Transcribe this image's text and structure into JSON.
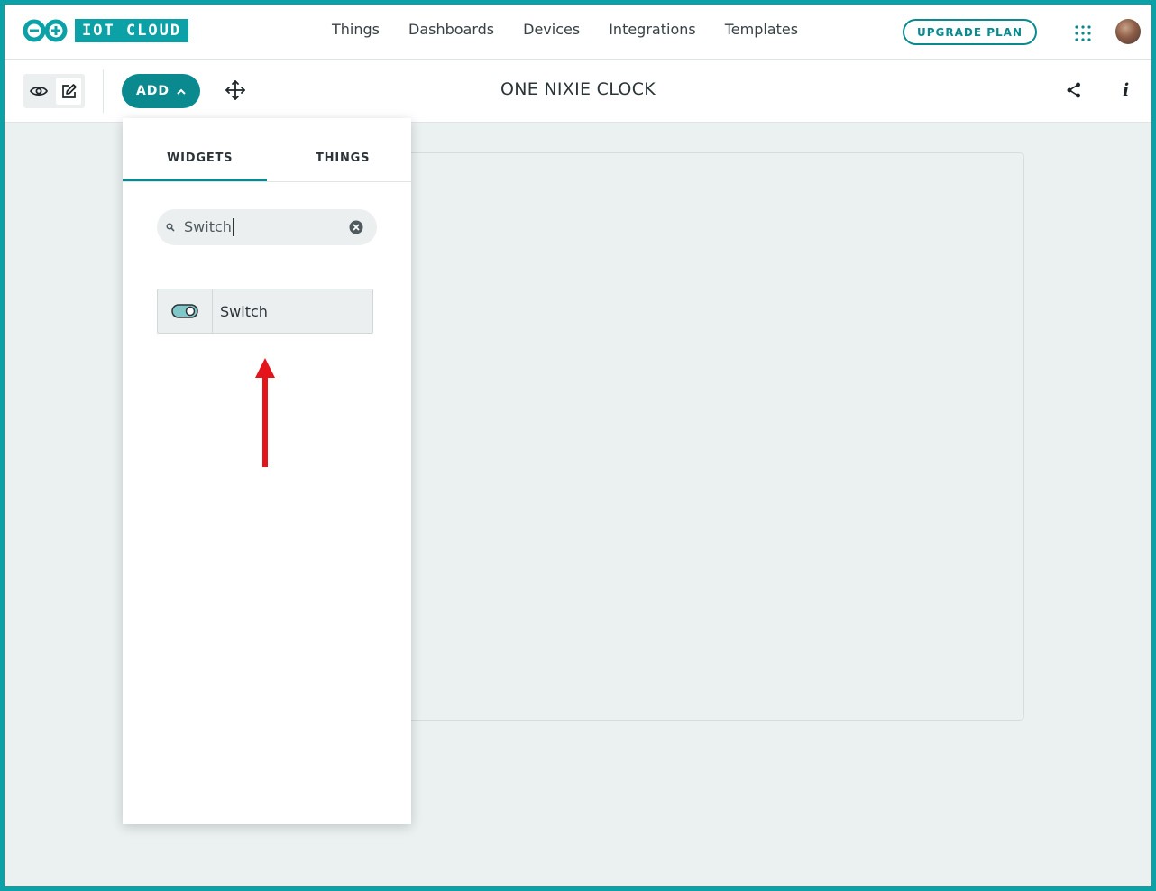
{
  "header": {
    "logo_text": "IOT CLOUD",
    "nav": [
      "Things",
      "Dashboards",
      "Devices",
      "Integrations",
      "Templates"
    ],
    "upgrade_label": "UPGRADE PLAN"
  },
  "toolbar": {
    "add_label": "ADD",
    "dashboard_title": "ONE NIXIE CLOCK",
    "info_glyph": "i"
  },
  "panel": {
    "tabs": [
      "WIDGETS",
      "THINGS"
    ],
    "active_tab": "WIDGETS",
    "search_value": "Switch",
    "results": [
      {
        "label": "Switch",
        "icon": "toggle-switch-icon"
      }
    ]
  },
  "annotation": {
    "color": "#e3151a",
    "icon": "red-arrow-up"
  },
  "colors": {
    "brand": "#0ca1a6",
    "accent": "#0a8a8f",
    "workspace_bg": "#ebf1f1"
  }
}
